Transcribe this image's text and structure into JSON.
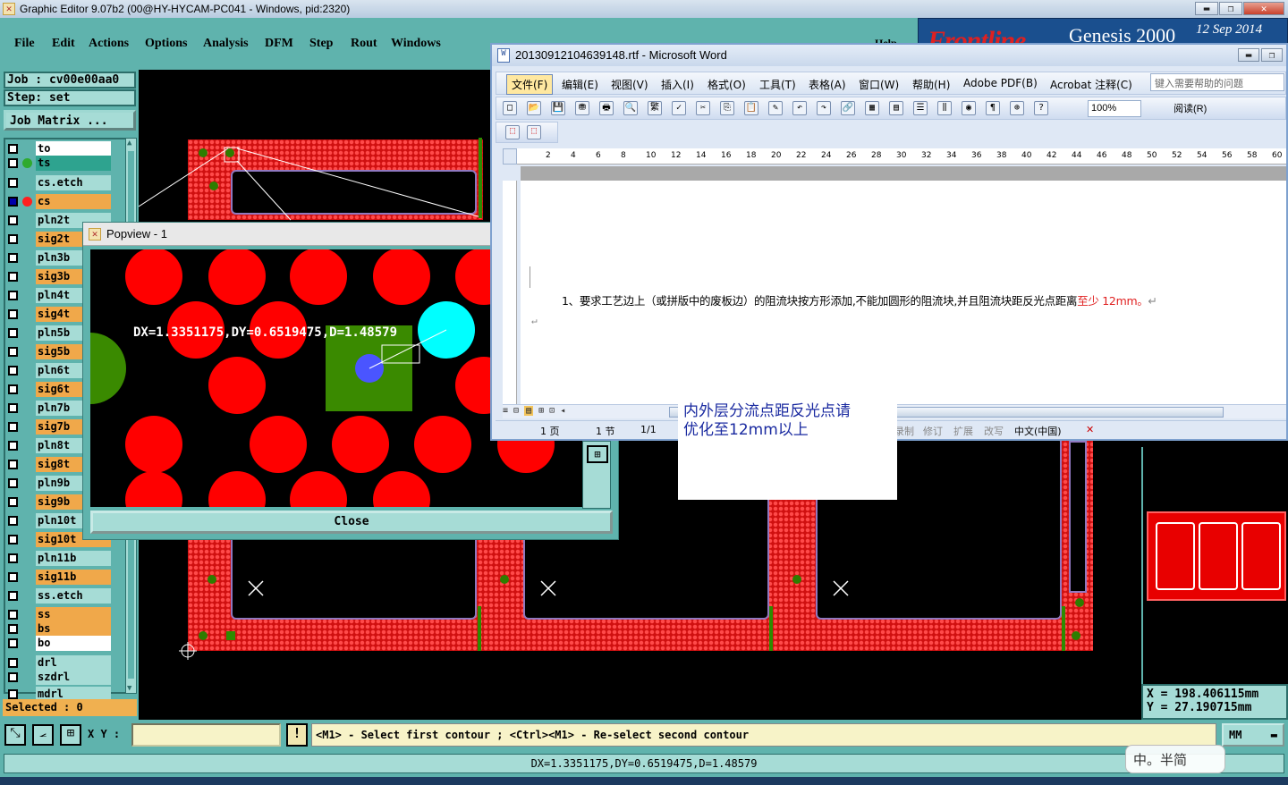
{
  "genesis": {
    "title": "Graphic Editor 9.07b2 (00@HY-HYCAM-PC041 - Windows, pid:2320)",
    "menu": [
      "File",
      "Edit",
      "Actions",
      "Options",
      "Analysis",
      "DFM",
      "Step",
      "Rout",
      "Windows"
    ],
    "help": "Help",
    "brand": "Frontline",
    "product": "Genesis 2000",
    "date": "12  Sep 2014",
    "job_label": "Job  :  cv00e00aa0",
    "step_label": "Step:  set",
    "job_matrix": "Job Matrix ...",
    "layers": [
      {
        "name": "to",
        "color": "#ffffff",
        "dot": ""
      },
      {
        "name": "ts",
        "color": "#2ea38f",
        "dot": "#2faa2f"
      },
      {
        "name": "cs.etch",
        "color": "#a6dcd6",
        "dot": ""
      },
      {
        "name": "cs",
        "color": "#f0a84a",
        "dot": "#ff2020"
      },
      {
        "name": "pln2t",
        "color": "#a6dcd6",
        "dot": ""
      },
      {
        "name": "sig2t",
        "color": "#f0a84a",
        "dot": ""
      },
      {
        "name": "pln3b",
        "color": "#a6dcd6",
        "dot": ""
      },
      {
        "name": "sig3b",
        "color": "#f0a84a",
        "dot": ""
      },
      {
        "name": "pln4t",
        "color": "#a6dcd6",
        "dot": ""
      },
      {
        "name": "sig4t",
        "color": "#f0a84a",
        "dot": ""
      },
      {
        "name": "pln5b",
        "color": "#a6dcd6",
        "dot": ""
      },
      {
        "name": "sig5b",
        "color": "#f0a84a",
        "dot": ""
      },
      {
        "name": "pln6t",
        "color": "#a6dcd6",
        "dot": ""
      },
      {
        "name": "sig6t",
        "color": "#f0a84a",
        "dot": ""
      },
      {
        "name": "pln7b",
        "color": "#a6dcd6",
        "dot": ""
      },
      {
        "name": "sig7b",
        "color": "#f0a84a",
        "dot": ""
      },
      {
        "name": "pln8t",
        "color": "#a6dcd6",
        "dot": ""
      },
      {
        "name": "sig8t",
        "color": "#f0a84a",
        "dot": ""
      },
      {
        "name": "pln9b",
        "color": "#a6dcd6",
        "dot": ""
      },
      {
        "name": "sig9b",
        "color": "#f0a84a",
        "dot": ""
      },
      {
        "name": "pln10t",
        "color": "#a6dcd6",
        "dot": ""
      },
      {
        "name": "sig10t",
        "color": "#f0a84a",
        "dot": ""
      },
      {
        "name": "pln11b",
        "color": "#a6dcd6",
        "dot": ""
      },
      {
        "name": "sig11b",
        "color": "#f0a84a",
        "dot": ""
      },
      {
        "name": "ss.etch",
        "color": "#a6dcd6",
        "dot": ""
      },
      {
        "name": "ss",
        "color": "#f0a84a",
        "dot": ""
      },
      {
        "name": "bs",
        "color": "#f0a84a",
        "dot": ""
      },
      {
        "name": "bo",
        "color": "#ffffff",
        "dot": ""
      },
      {
        "name": "drl",
        "color": "#a6dcd6",
        "dot": ""
      },
      {
        "name": "szdrl",
        "color": "#a6dcd6",
        "dot": ""
      },
      {
        "name": "mdrl",
        "color": "#a6dcd6",
        "dot": ""
      }
    ],
    "selected": "Selected : 0",
    "coord_x": "X  =  198.406115mm",
    "coord_y": "Y  =  27.190715mm",
    "xy_label": "X Y :",
    "prompt": "<M1> - Select first contour ; <Ctrl><M1> - Re-select second contour",
    "units": "MM",
    "status": "DX=1.3351175,DY=0.6519475,D=1.48579"
  },
  "popview": {
    "title": "Popview - 1",
    "measure": "DX=1.3351175,DY=0.6519475,D=1.48579",
    "close": "Close"
  },
  "word": {
    "title": "20130912104639148.rtf - Microsoft Word",
    "menu": [
      "文件(F)",
      "编辑(E)",
      "视图(V)",
      "插入(I)",
      "格式(O)",
      "工具(T)",
      "表格(A)",
      "窗口(W)",
      "帮助(H)",
      "Adobe PDF(B)",
      "Acrobat 注释(C)"
    ],
    "help_box": "键入需要帮助的问题",
    "zoom": "100%",
    "read": "阅读(R)",
    "ruler": [
      "2",
      "4",
      "6",
      "8",
      "10",
      "12",
      "14",
      "16",
      "18",
      "20",
      "22",
      "24",
      "26",
      "28",
      "30",
      "32",
      "34",
      "36",
      "38",
      "40",
      "42",
      "44",
      "46",
      "48",
      "50",
      "52",
      "54",
      "56",
      "58",
      "60"
    ],
    "body_text": "1、要求工艺边上（或拼版中的废板边）的阻流块按方形添加,不能加圆形的阻流块,并且阻流块距反光点距离",
    "body_red": "至少 12mm。",
    "status": {
      "page": "1 页",
      "section": "1 节",
      "pages": "1/1",
      "rec": "录制",
      "trk": "修订",
      "ext": "扩展",
      "ovr": "改写",
      "lang": "中文(中国)"
    }
  },
  "note": {
    "line1": "内外层分流点距反光点请",
    "line2": "优化至12mm以上"
  },
  "ime": "中。半简",
  "colors": {
    "teal": "#5fb3ad",
    "red": "#ff0000",
    "green": "#2e8b00",
    "cyan": "#00ffff",
    "blue": "#4466ff"
  }
}
